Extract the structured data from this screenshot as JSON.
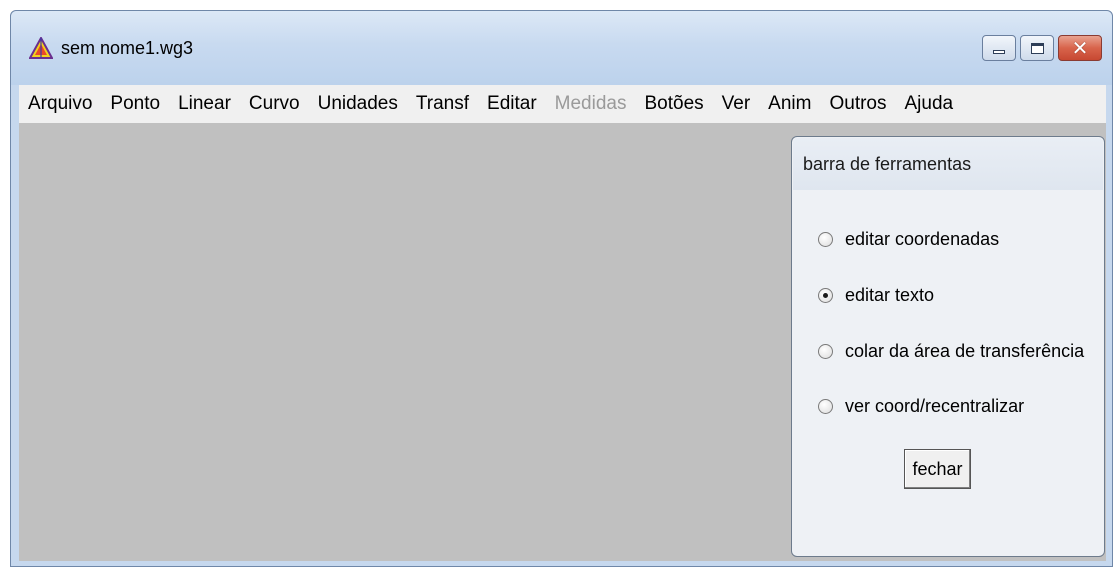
{
  "window": {
    "title": "sem nome1.wg3",
    "app_icon": "triangle-icon",
    "controls": {
      "minimize_icon": "minimize-icon",
      "maximize_icon": "maximize-icon",
      "close_label": "✕"
    }
  },
  "menubar": {
    "items": [
      {
        "label": "Arquivo",
        "enabled": true
      },
      {
        "label": "Ponto",
        "enabled": true
      },
      {
        "label": "Linear",
        "enabled": true
      },
      {
        "label": "Curvo",
        "enabled": true
      },
      {
        "label": "Unidades",
        "enabled": true
      },
      {
        "label": "Transf",
        "enabled": true
      },
      {
        "label": "Editar",
        "enabled": true
      },
      {
        "label": "Medidas",
        "enabled": false
      },
      {
        "label": "Botões",
        "enabled": true
      },
      {
        "label": "Ver",
        "enabled": true
      },
      {
        "label": "Anim",
        "enabled": true
      },
      {
        "label": "Outros",
        "enabled": true
      },
      {
        "label": "Ajuda",
        "enabled": true
      }
    ]
  },
  "toolbar_panel": {
    "title": "barra de ferramentas",
    "options": [
      {
        "label": "editar coordenadas",
        "checked": false
      },
      {
        "label": "editar texto",
        "checked": true
      },
      {
        "label": "colar da área de transferência",
        "checked": false
      },
      {
        "label": "ver coord/recentralizar",
        "checked": false
      }
    ],
    "close_button": "fechar"
  },
  "colors": {
    "canvas": "#c0c0c0",
    "titlebar": "#c8daf0",
    "menubar": "#f0f0f0",
    "disabled_text": "#9a9a9a"
  }
}
